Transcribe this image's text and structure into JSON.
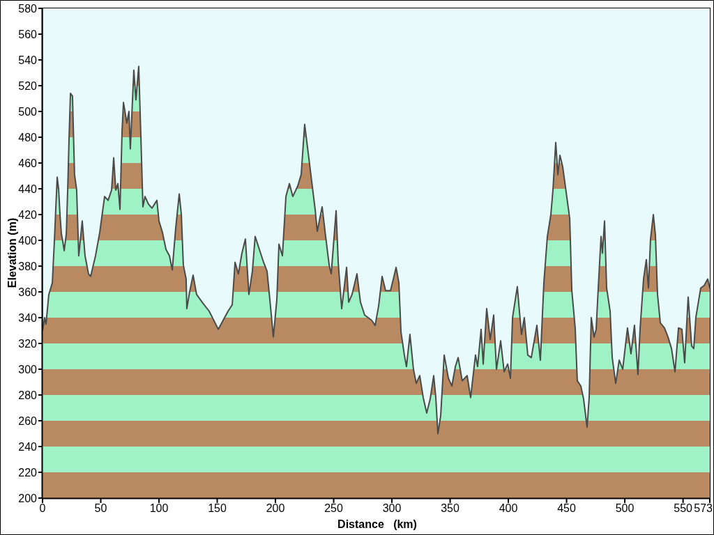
{
  "elevation_profile": {
    "chart_data": {
      "type": "area",
      "xlabel": "Distance   (km)",
      "ylabel": "Elevation (m)",
      "x": [
        0,
        1.8,
        3.0,
        5.4,
        8.4,
        10.2,
        11.4,
        12.6,
        13.8,
        15.0,
        16.2,
        17.4,
        18.6,
        20.4,
        21.6,
        22.8,
        24.0,
        25.7,
        27.5,
        29.3,
        31.1,
        34.1,
        36.5,
        39.5,
        41.3,
        45.5,
        49.1,
        53.3,
        56.3,
        59.3,
        61.1,
        62.9,
        64.7,
        66.5,
        68.3,
        69.5,
        72.4,
        74.2,
        75.4,
        78.4,
        80.2,
        82.6,
        84.4,
        86.2,
        88.0,
        91.0,
        94.0,
        98.2,
        100.0,
        103.0,
        106.0,
        109.0,
        111.4,
        114.4,
        117.4,
        119.2,
        120.9,
        123.3,
        123.9,
        126.3,
        129.3,
        132.3,
        137.1,
        143.1,
        150.9,
        155.1,
        159.3,
        162.9,
        165.3,
        168.2,
        171.2,
        174.2,
        177.2,
        180.2,
        182.6,
        186.2,
        189.8,
        192.8,
        195.2,
        198.2,
        201.2,
        203.0,
        206.0,
        209.0,
        212.0,
        214.9,
        219.1,
        222.1,
        225.1,
        228.1,
        231.1,
        234.1,
        235.9,
        240.1,
        243.1,
        246.1,
        247.9,
        252.1,
        253.9,
        256.9,
        261.1,
        262.9,
        265.8,
        270.0,
        273.0,
        276.6,
        282.6,
        285.6,
        288.6,
        291.6,
        294.6,
        298.8,
        301.8,
        303.6,
        306.0,
        307.8,
        310.7,
        312.5,
        315.5,
        318.5,
        320.9,
        323.9,
        326.9,
        329.9,
        332.9,
        335.9,
        337.7,
        339.5,
        341.9,
        344.9,
        348.5,
        351.5,
        354.5,
        356.9,
        360.4,
        364.6,
        367.6,
        371.8,
        373.6,
        376.6,
        378.4,
        381.4,
        384.4,
        387.4,
        389.8,
        393.4,
        396.4,
        399.4,
        401.8,
        403.6,
        407.7,
        409.5,
        411.3,
        413.7,
        416.7,
        419.7,
        424.5,
        427.5,
        430.5,
        433.5,
        436.5,
        438.3,
        440.7,
        442.5,
        444.3,
        446.7,
        449.7,
        452.7,
        454.5,
        457.4,
        459.2,
        462.2,
        464.6,
        467.6,
        469.4,
        471.2,
        473.6,
        475.4,
        477.2,
        479.6,
        480.8,
        482.6,
        484.4,
        487.4,
        489.2,
        492.2,
        495.2,
        498.2,
        502.3,
        505.3,
        508.3,
        511.3,
        513.1,
        516.1,
        518.5,
        520.3,
        522.1,
        524.5,
        526.3,
        528.1,
        530.5,
        534.1,
        537.1,
        540.1,
        543.1,
        546.1,
        549.0,
        551.4,
        554.4,
        557.4,
        559.2,
        561.0,
        565.2,
        568.2,
        571.2,
        573
      ],
      "values": [
        330,
        340,
        335,
        358,
        367,
        400,
        425,
        449,
        440,
        420,
        405,
        399,
        392,
        405,
        439,
        480,
        514,
        512,
        451,
        439,
        388,
        415,
        388,
        374,
        372,
        388,
        406,
        434,
        431,
        439,
        464,
        439,
        444,
        424,
        485,
        507,
        491,
        500,
        471,
        532,
        509,
        535,
        482,
        426,
        434,
        428,
        425,
        431,
        415,
        406,
        393,
        388,
        377,
        410,
        436,
        420,
        381,
        370,
        347,
        360,
        373,
        358,
        352,
        345,
        331,
        338,
        345,
        350,
        383,
        374,
        390,
        401,
        358,
        376,
        403,
        393,
        383,
        376,
        354,
        325,
        354,
        397,
        388,
        434,
        444,
        434,
        442,
        451,
        490,
        468,
        446,
        424,
        407,
        426,
        403,
        381,
        374,
        423,
        383,
        347,
        379,
        352,
        358,
        374,
        352,
        342,
        338,
        334,
        349,
        372,
        361,
        361,
        372,
        379,
        367,
        329,
        311,
        302,
        327,
        300,
        289,
        295,
        278,
        266,
        277,
        295,
        278,
        250,
        264,
        311,
        293,
        287,
        302,
        309,
        291,
        295,
        278,
        311,
        302,
        331,
        304,
        347,
        323,
        342,
        300,
        322,
        298,
        304,
        293,
        340,
        364,
        345,
        327,
        340,
        311,
        309,
        334,
        307,
        367,
        403,
        420,
        439,
        476,
        451,
        466,
        457,
        437,
        417,
        361,
        332,
        291,
        287,
        277,
        255,
        278,
        340,
        325,
        331,
        363,
        403,
        390,
        415,
        363,
        345,
        309,
        289,
        307,
        300,
        332,
        312,
        334,
        296,
        331,
        370,
        385,
        363,
        401,
        420,
        404,
        358,
        336,
        332,
        325,
        316,
        298,
        332,
        331,
        305,
        356,
        318,
        316,
        340,
        363,
        365,
        370,
        363
      ],
      "xlim": [
        0,
        573
      ],
      "ylim": [
        200,
        580
      ],
      "xticks": [
        0,
        50,
        100,
        150,
        200,
        250,
        300,
        350,
        400,
        450,
        500,
        550,
        573
      ],
      "yticks": [
        200,
        220,
        240,
        260,
        280,
        300,
        320,
        340,
        360,
        380,
        400,
        420,
        440,
        460,
        480,
        500,
        520,
        540,
        560,
        580
      ]
    }
  }
}
